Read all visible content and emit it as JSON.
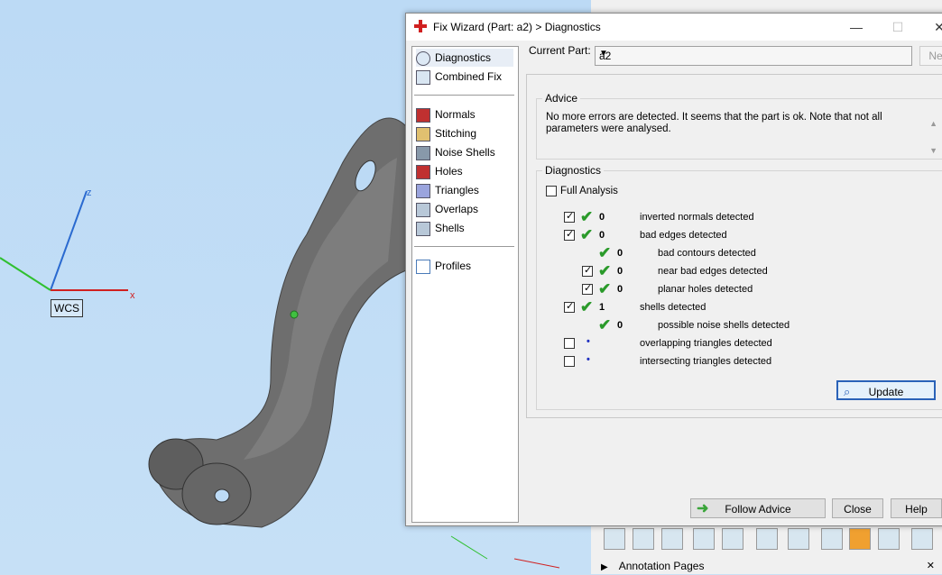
{
  "viewport": {
    "wcs_label": "WCS",
    "axis_z": "z",
    "axis_x": "x"
  },
  "dialog": {
    "title": "Fix Wizard (Part: a2) > Diagnostics",
    "nav": {
      "top": [
        {
          "label": "Diagnostics",
          "icon": "magnifier-icon",
          "selected": true
        },
        {
          "label": "Combined Fix",
          "icon": "cube-icon"
        }
      ],
      "middle": [
        {
          "label": "Normals",
          "icon": "normals-cube-icon"
        },
        {
          "label": "Stitching",
          "icon": "stitching-cube-icon"
        },
        {
          "label": "Noise Shells",
          "icon": "noise-shells-icon"
        },
        {
          "label": "Holes",
          "icon": "holes-cube-icon"
        },
        {
          "label": "Triangles",
          "icon": "triangles-cube-icon"
        },
        {
          "label": "Overlaps",
          "icon": "overlaps-cube-icon"
        },
        {
          "label": "Shells",
          "icon": "shells-cube-icon"
        }
      ],
      "bottom": [
        {
          "label": "Profiles",
          "icon": "document-icon"
        }
      ]
    },
    "current_part_label": "Current Part:",
    "current_part_value": "a2",
    "next_label": "Nex",
    "advice": {
      "title": "Advice",
      "text": "No more errors are detected. It seems that the part is ok. Note that not all parameters were analysed."
    },
    "diagnostics": {
      "title": "Diagnostics",
      "full_analysis_label": "Full Analysis",
      "rows": [
        {
          "checkbox": true,
          "checked": true,
          "status": "ok",
          "value": "0",
          "label": "inverted normals detected",
          "indent": 0
        },
        {
          "checkbox": true,
          "checked": true,
          "status": "ok",
          "value": "0",
          "label": "bad edges detected",
          "indent": 0
        },
        {
          "checkbox": false,
          "checked": false,
          "status": "ok",
          "value": "0",
          "label": "bad contours detected",
          "indent": 1
        },
        {
          "checkbox": true,
          "checked": true,
          "status": "ok",
          "value": "0",
          "label": "near bad edges detected",
          "indent": 1
        },
        {
          "checkbox": true,
          "checked": true,
          "status": "ok",
          "value": "0",
          "label": "planar holes detected",
          "indent": 1
        },
        {
          "checkbox": true,
          "checked": true,
          "status": "ok",
          "value": "1",
          "label": "shells detected",
          "indent": 0
        },
        {
          "checkbox": false,
          "checked": false,
          "status": "ok",
          "value": "0",
          "label": "possible noise shells detected",
          "indent": 1
        },
        {
          "checkbox": true,
          "checked": false,
          "status": "pending",
          "value": "",
          "label": "overlapping triangles detected",
          "indent": 0
        },
        {
          "checkbox": true,
          "checked": false,
          "status": "pending",
          "value": "",
          "label": "intersecting triangles detected",
          "indent": 0
        }
      ],
      "update_label": "Update"
    },
    "buttons": {
      "follow_advice": "Follow Advice",
      "close": "Close",
      "help": "Help"
    }
  },
  "bottom_panel": {
    "annotation_pages": "Annotation Pages"
  },
  "colors": {
    "viewport_bg": "#bcdaf5",
    "part_gray": "#6b6b6b",
    "ok_green": "#2a9a2a",
    "accent_blue": "#2a62b8"
  }
}
